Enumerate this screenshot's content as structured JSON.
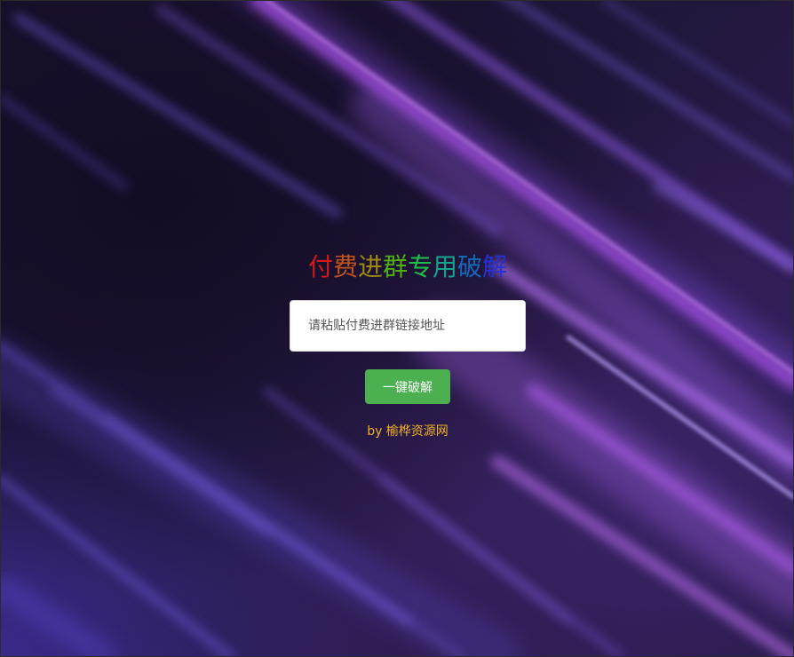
{
  "title": {
    "chars": [
      {
        "text": "付",
        "color": "#d11a1a"
      },
      {
        "text": "费",
        "color": "#c0541c"
      },
      {
        "text": "进",
        "color": "#9c8a14"
      },
      {
        "text": "群",
        "color": "#52b010"
      },
      {
        "text": "专",
        "color": "#1cc04a"
      },
      {
        "text": "用",
        "color": "#14a48c"
      },
      {
        "text": "破",
        "color": "#1468b8"
      },
      {
        "text": "解",
        "color": "#2430d8"
      }
    ]
  },
  "form": {
    "input_placeholder": "请粘贴付费进群链接地址",
    "input_value": "",
    "submit_label": "一键破解"
  },
  "footer": {
    "credit": "by 榆桦资源网",
    "credit_color": "#f0b020"
  },
  "background": {
    "base_color": "#1a1030",
    "streak_colors": [
      "#8a5cf0",
      "#b06ae8",
      "#6a5ad8"
    ]
  }
}
